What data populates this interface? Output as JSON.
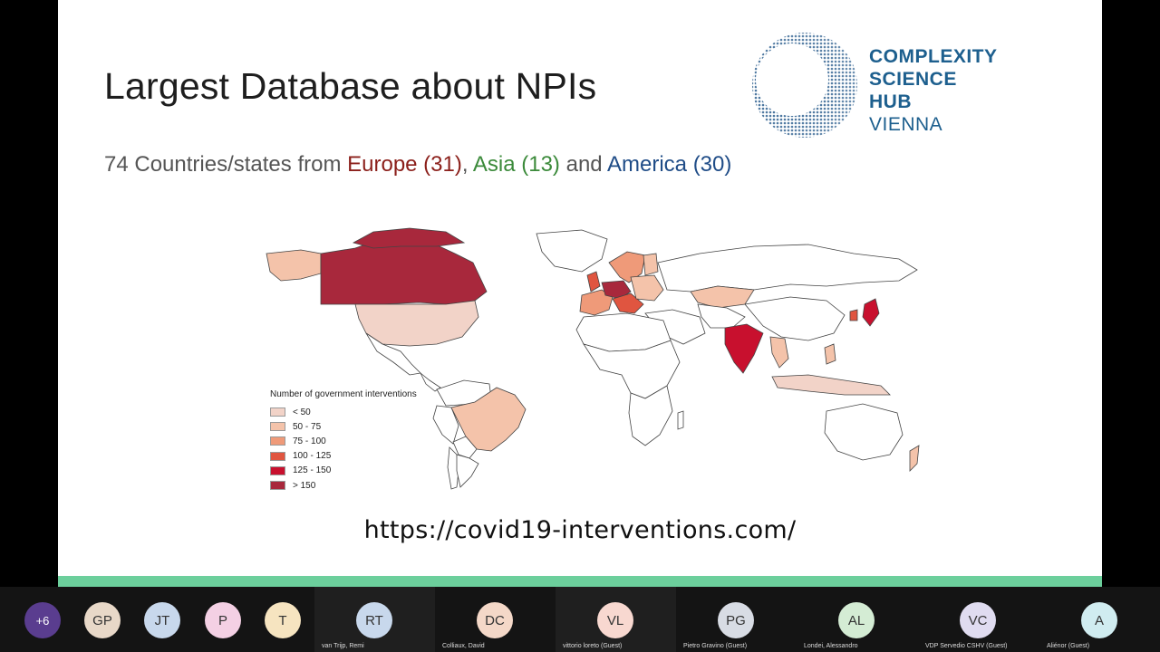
{
  "slide": {
    "title": "Largest Database about NPIs",
    "subtitle": {
      "prefix": "74 Countries/states from ",
      "europe": "Europe (31)",
      "sep1": ", ",
      "asia": "Asia (13)",
      "sep2": " and ",
      "america": "America (30)"
    },
    "logo": {
      "line1": "COMPLEXITY",
      "line2": "SCIENCE",
      "line3": "HUB",
      "line4": "VIENNA"
    },
    "url": "https://covid19-interventions.com/",
    "colors": {
      "europe": "#8b1f1a",
      "asia": "#3b8a3a",
      "america": "#1f4c87",
      "accent_bar": "#6ccf9c"
    }
  },
  "legend": {
    "title": "Number of government interventions",
    "items": [
      {
        "label": "< 50",
        "color": "#f2d3c8"
      },
      {
        "label": "50 - 75",
        "color": "#f4c3aa"
      },
      {
        "label": "75 - 100",
        "color": "#ef9a79"
      },
      {
        "label": "100 - 125",
        "color": "#e05540"
      },
      {
        "label": "125 - 150",
        "color": "#c8102e"
      },
      {
        "label": "> 150",
        "color": "#a8283c"
      }
    ]
  },
  "participants": [
    {
      "initials": "+6",
      "name": "",
      "color": "#5a3d8f"
    },
    {
      "initials": "GP",
      "name": "",
      "color": "#e8d8c8"
    },
    {
      "initials": "JT",
      "name": "",
      "color": "#c8d8ec"
    },
    {
      "initials": "P",
      "name": "",
      "color": "#f4d0e4"
    },
    {
      "initials": "T",
      "name": "",
      "color": "#f6e4c0"
    },
    {
      "initials": "RT",
      "name": "van Trijp, Remi",
      "color": "#c8d8ec"
    },
    {
      "initials": "DC",
      "name": "Colliaux, David",
      "color": "#f4d8c8"
    },
    {
      "initials": "VL",
      "name": "vittorio loreto (Guest)",
      "color": "#f8d8d0"
    },
    {
      "initials": "PG",
      "name": "Pietro Gravino (Guest)",
      "color": "#d8dce4"
    },
    {
      "initials": "AL",
      "name": "Londei, Alessandro",
      "color": "#d4ecd4"
    },
    {
      "initials": "VC",
      "name": "VDP Servedio CSHV (Guest)",
      "color": "#e0dcf0"
    },
    {
      "initials": "A",
      "name": "Aliénor (Guest)",
      "color": "#d0ecf0"
    }
  ]
}
